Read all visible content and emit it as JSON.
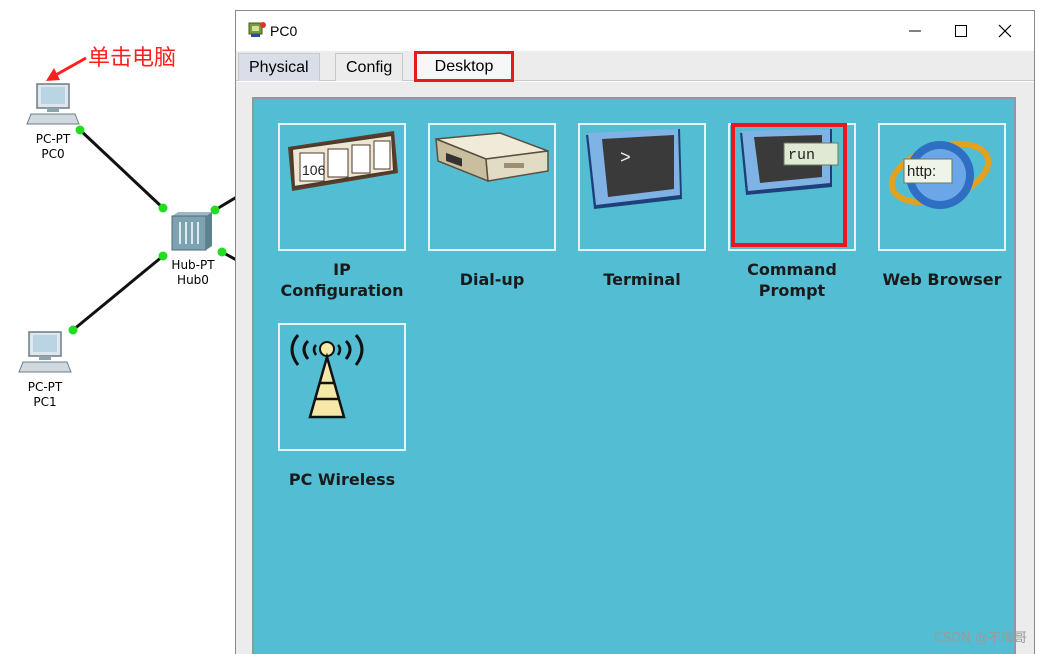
{
  "topology": {
    "annotation": "单击电脑",
    "pc0": {
      "type": "PC-PT",
      "name": "PC0"
    },
    "hub0": {
      "type": "Hub-PT",
      "name": "Hub0"
    },
    "pc1": {
      "type": "PC-PT",
      "name": "PC1"
    }
  },
  "window": {
    "title": "PC0",
    "tabs": [
      "Physical",
      "Config",
      "Desktop"
    ],
    "active_tab": "Desktop"
  },
  "desktop": {
    "apps": [
      {
        "label_line1": "IP",
        "label_line2": "Configuration",
        "icon": "ip-config-icon"
      },
      {
        "label_line1": "Dial-up",
        "label_line2": "",
        "icon": "dialup-modem-icon"
      },
      {
        "label_line1": "Terminal",
        "label_line2": "",
        "icon": "terminal-icon"
      },
      {
        "label_line1": "Command",
        "label_line2": "Prompt",
        "icon": "command-prompt-icon"
      },
      {
        "label_line1": "Web Browser",
        "label_line2": "",
        "icon": "web-browser-icon"
      },
      {
        "label_line1": "PC Wireless",
        "label_line2": "",
        "icon": "wireless-tower-icon"
      }
    ],
    "ip_icon_text": "106",
    "terminal_icon_text": ">",
    "cmd_icon_text": "run",
    "browser_icon_text": "http:"
  },
  "colors": {
    "highlight": "#e8191b",
    "desktop_bg": "#53bdd3",
    "link_active": "#22dd22"
  },
  "watermark": "CSDN @不悔哥"
}
